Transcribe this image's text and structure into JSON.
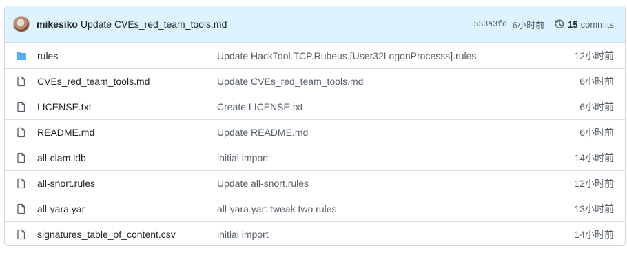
{
  "commit": {
    "author": "mikesiko",
    "message": "Update CVEs_red_team_tools.md",
    "sha": "553a3fd",
    "ago": "6小时前",
    "commits_count": "15",
    "commits_label": "commits"
  },
  "colors": {
    "header_bg": "#ddf4ff",
    "folder_icon": "#54aeff",
    "file_icon": "#57606a",
    "text_primary": "#1f2328",
    "text_muted": "#57606a"
  },
  "files": [
    {
      "icon": "folder-icon",
      "name": "rules",
      "message": "Update HackTool.TCP.Rubeus.[User32LogonProcesss].rules",
      "time": "12小时前"
    },
    {
      "icon": "file-icon",
      "name": "CVEs_red_team_tools.md",
      "message": "Update CVEs_red_team_tools.md",
      "time": "6小时前"
    },
    {
      "icon": "file-icon",
      "name": "LICENSE.txt",
      "message": "Create LICENSE.txt",
      "time": "6小时前"
    },
    {
      "icon": "file-icon",
      "name": "README.md",
      "message": "Update README.md",
      "time": "6小时前"
    },
    {
      "icon": "file-icon",
      "name": "all-clam.ldb",
      "message": "initial import",
      "time": "14小时前"
    },
    {
      "icon": "file-icon",
      "name": "all-snort.rules",
      "message": "Update all-snort.rules",
      "time": "12小时前"
    },
    {
      "icon": "file-icon",
      "name": "all-yara.yar",
      "message": "all-yara.yar: tweak two rules",
      "time": "13小时前"
    },
    {
      "icon": "file-icon",
      "name": "signatures_table_of_content.csv",
      "message": "initial import",
      "time": "14小时前"
    }
  ]
}
